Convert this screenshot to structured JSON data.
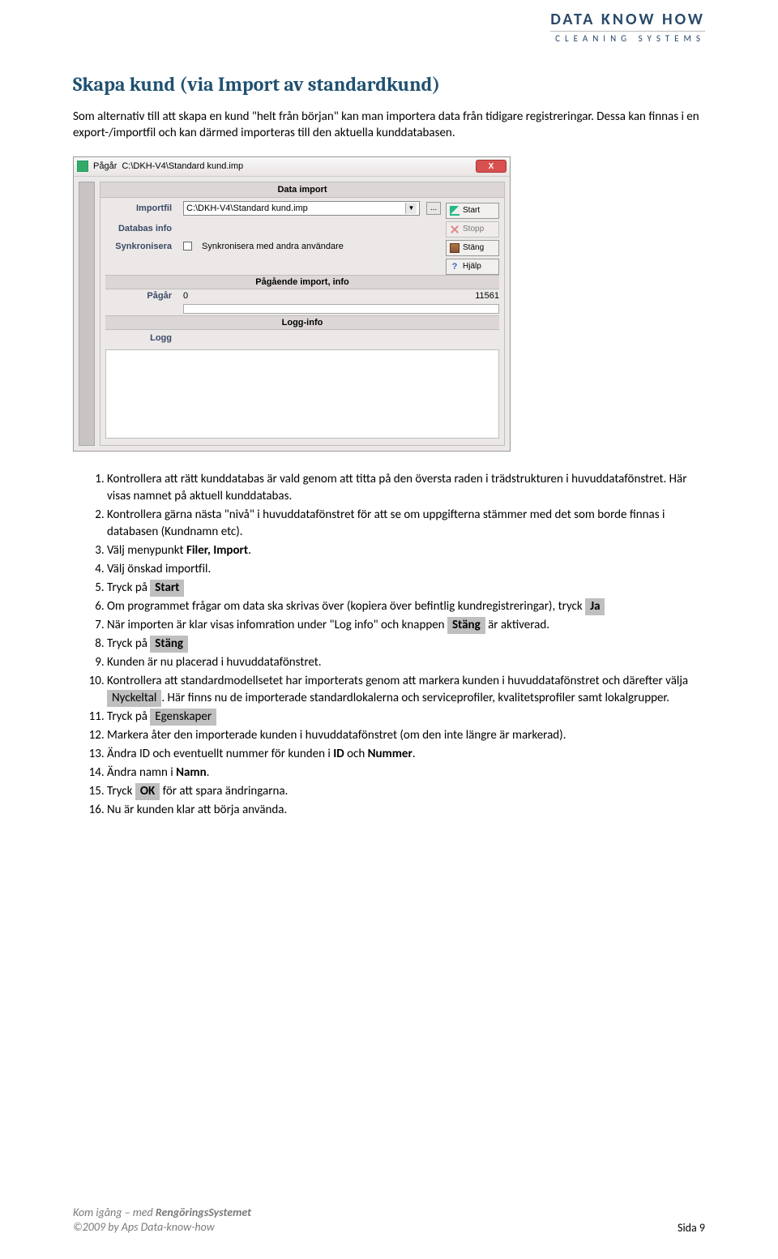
{
  "brand": {
    "top": "DATA KNOW HOW",
    "sub": "CLEANING SYSTEMS"
  },
  "heading": "Skapa kund (via Import av standardkund)",
  "intro": "Som alternativ till att skapa en kund \"helt från början\" kan man importera data från tidigare registreringar. Dessa kan finnas i en export-/importfil och kan därmed importeras till den aktuella kunddatabasen.",
  "dialog": {
    "titlebar_label": "Pågår",
    "titlebar_path": "C:\\DKH-V4\\Standard kund.imp",
    "close": "X",
    "header": "Data import",
    "labels": {
      "importfil": "Importfil",
      "databas_info": "Databas info",
      "synkronisera": "Synkronisera",
      "pagar": "Pågår",
      "logg": "Logg"
    },
    "importfil_value": "C:\\DKH-V4\\Standard kund.imp",
    "browse": "...",
    "sync_text": "Synkronisera med andra användare",
    "buttons": {
      "start": "Start",
      "stopp": "Stopp",
      "stang": "Stäng",
      "hjalp": "Hjälp"
    },
    "progress_header": "Pågående import, info",
    "progress_start": "0",
    "progress_end": "11561",
    "logg_header": "Logg-info"
  },
  "steps": {
    "s1": "Kontrollera att rätt kunddatabas är vald genom att titta på den översta raden i trädstrukturen i huvuddatafönstret. Här visas namnet på aktuell kunddatabas.",
    "s2": "Kontrollera gärna nästa \"nivå\" i huvuddatafönstret för att se om uppgifterna stämmer med det som borde finnas i databasen (Kundnamn etc).",
    "s3_pre": "Välj menypunkt ",
    "s3_bold": "Filer, Import",
    "s3_post": ".",
    "s4": "Välj önskad importfil.",
    "s5_pre": "Tryck på ",
    "s5_btn": "Start",
    "s6_pre": "Om programmet frågar om data ska skrivas över (kopiera över befintlig kundregistreringar), tryck ",
    "s6_btn": "Ja",
    "s7_pre": "När importen är klar visas infomration under \"Log info\" och knappen ",
    "s7_btn": "Stäng",
    "s7_post": " är aktiverad.",
    "s8_pre": "Tryck på ",
    "s8_btn": "Stäng",
    "s9": "Kunden är nu placerad i huvuddatafönstret.",
    "s10_pre": "Kontrollera att standardmodellsetet har importerats genom att markera kunden i huvuddatafönstret och därefter välja ",
    "s10_btn": "Nyckeltal",
    "s10_post": ". Här finns nu de importerade standardlokalerna och serviceprofiler, kvalitetsprofiler samt lokalgrupper.",
    "s11_pre": "Tryck på ",
    "s11_btn": "Egenskaper",
    "s12": "Markera åter den importerade kunden i huvuddatafönstret (om den inte längre är markerad).",
    "s13_pre": "Ändra ID och eventuellt nummer för kunden i ",
    "s13_b1": "ID",
    "s13_mid": " och ",
    "s13_b2": "Nummer",
    "s13_post": ".",
    "s14_pre": "Ändra namn i ",
    "s14_b": "Namn",
    "s14_post": ".",
    "s15_pre": "Tryck ",
    "s15_btn": "OK",
    "s15_post": " för att spara ändringarna.",
    "s16": "Nu är kunden klar att börja använda."
  },
  "footer": {
    "line1_pre": "Kom igång  – med ",
    "line1_bold": "RengöringsSystemet",
    "line2": "©2009 by Aps Data-know-how",
    "page": "Sida 9"
  }
}
